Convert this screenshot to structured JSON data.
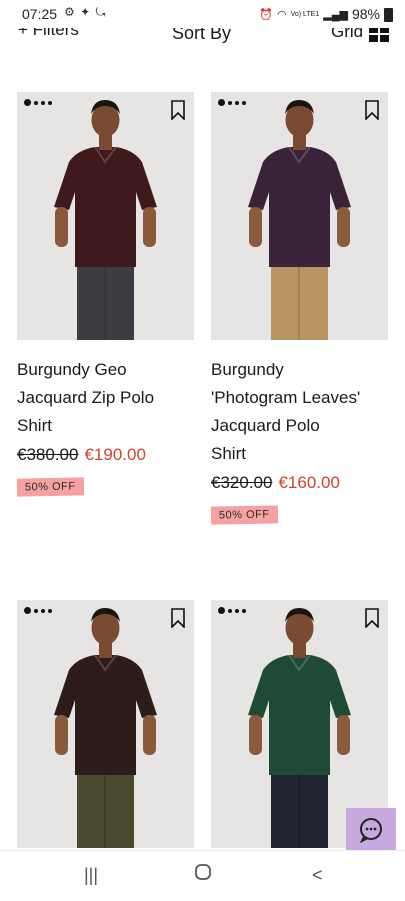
{
  "status_bar": {
    "time": "07:25",
    "left_icons": "⚙ ✦ ⤿",
    "network": "Vo) LTE1",
    "battery": "98%"
  },
  "toolbar": {
    "filters_label": "+ Filters",
    "sort_label": "Sort By",
    "grid_label": "Grid"
  },
  "products": [
    {
      "title_lines": [
        "Burgundy Geo",
        "Jacquard Zip Polo",
        "Shirt"
      ],
      "old_price": "€380.00",
      "new_price": "€190.00",
      "badge": "50% OFF",
      "shirt_color": "#3e1a1c",
      "trouser_color": "#3b3d42"
    },
    {
      "title_lines": [
        "Burgundy",
        "'Photogram Leaves'",
        "Jacquard Polo",
        "Shirt"
      ],
      "old_price": "€320.00",
      "new_price": "€160.00",
      "badge": "50% OFF",
      "shirt_color": "#3a2238",
      "trouser_color": "#b89460"
    },
    {
      "title_lines": [],
      "shirt_color": "#2e1c1a",
      "trouser_color": "#4a4a2e"
    },
    {
      "title_lines": [],
      "shirt_color": "#1f4a36",
      "trouser_color": "#1f2430"
    }
  ],
  "colors": {
    "sale_price": "#d0432f",
    "badge_bg": "#f4a1a0",
    "chat_fab": "#c7a8df",
    "card_bg": "#e6e5e3"
  },
  "icons": {
    "bookmark": "bookmark-icon",
    "chat": "chat-bubble-icon",
    "grid": "grid-icon",
    "nav_recents": "recents-icon",
    "nav_home": "home-icon",
    "nav_back": "back-icon"
  }
}
